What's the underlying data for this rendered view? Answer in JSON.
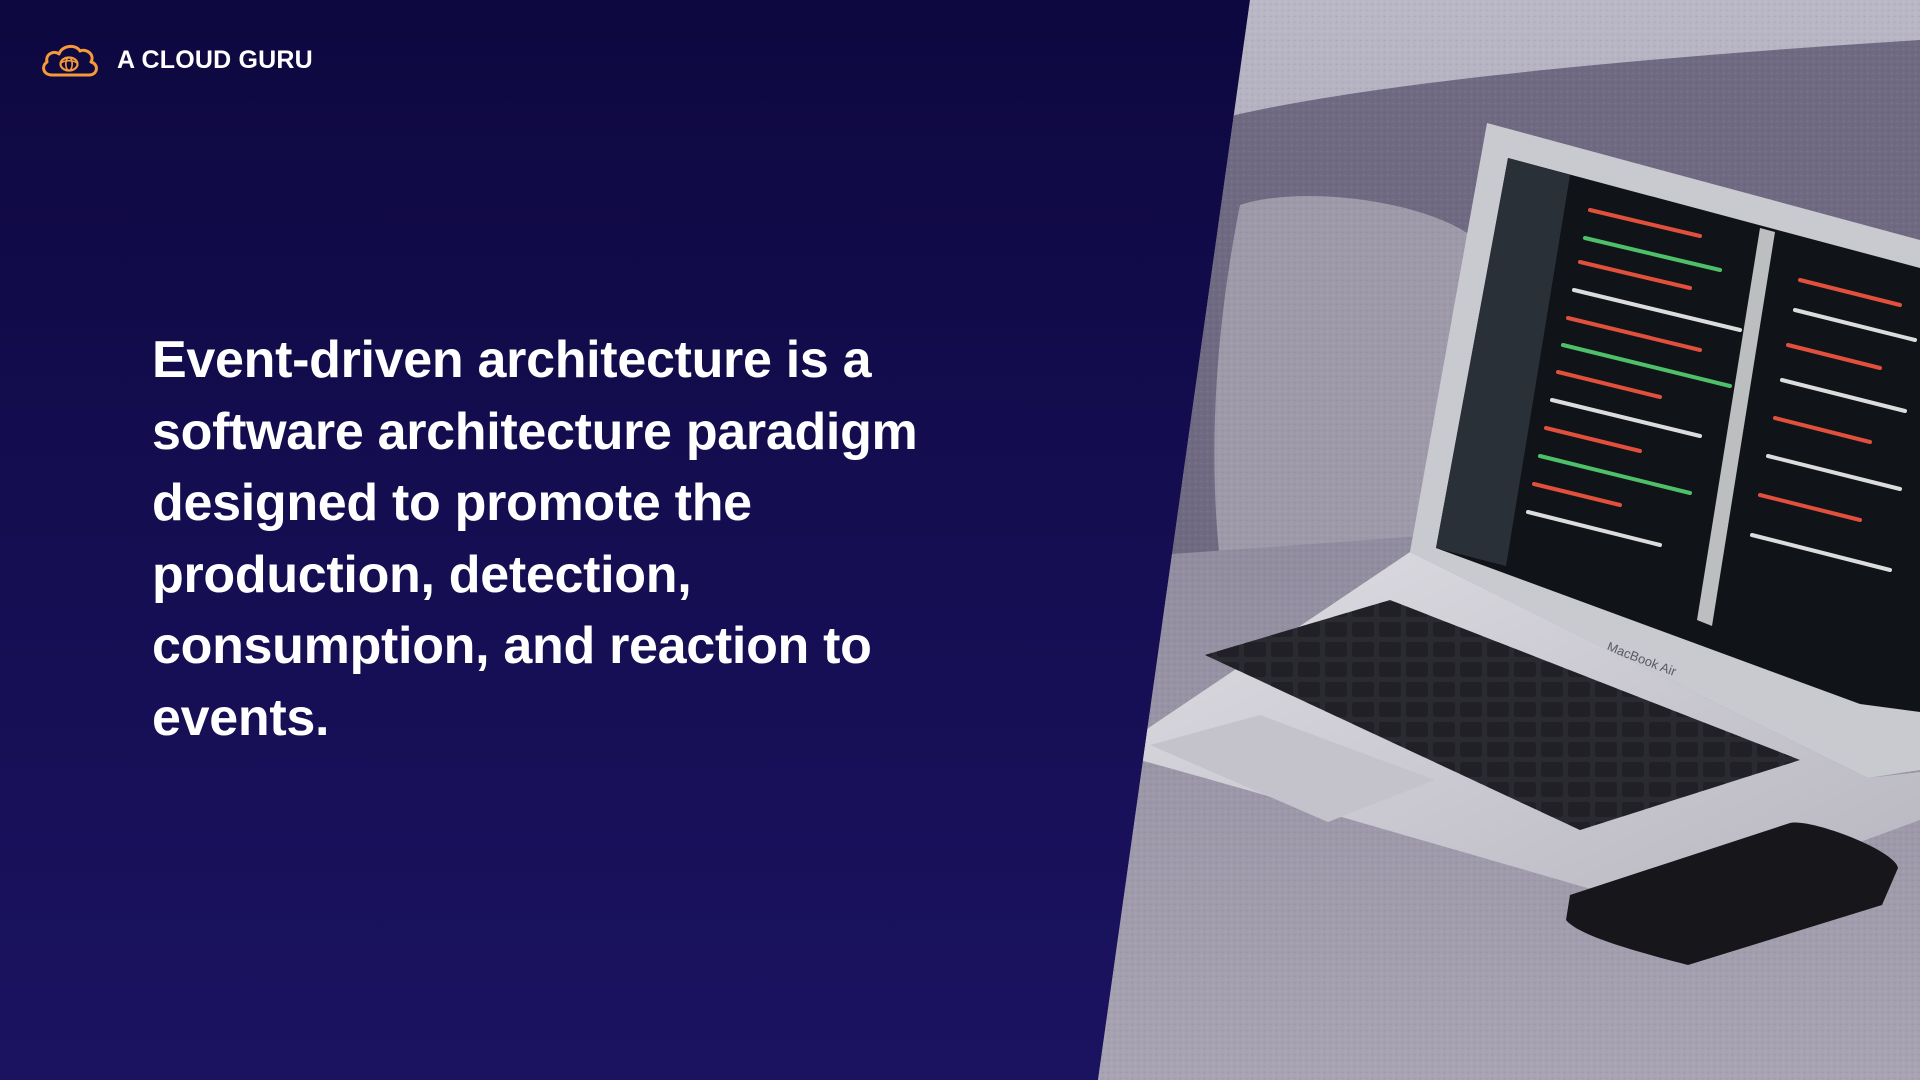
{
  "brand": {
    "name": "A CLOUD GURU",
    "logo_icon": "cloud-icon",
    "accent_color": "#f59a3a"
  },
  "slide": {
    "background_color": "#140d50",
    "text_color": "#ffffff",
    "headline_lines": [
      "Event-driven architecture is a",
      "software architecture paradigm",
      "designed to promote the",
      "production, detection,",
      "consumption, and reaction to",
      "events."
    ]
  },
  "photo": {
    "subject": "laptop-with-code-on-couch",
    "laptop_label": "MacBook Air"
  }
}
